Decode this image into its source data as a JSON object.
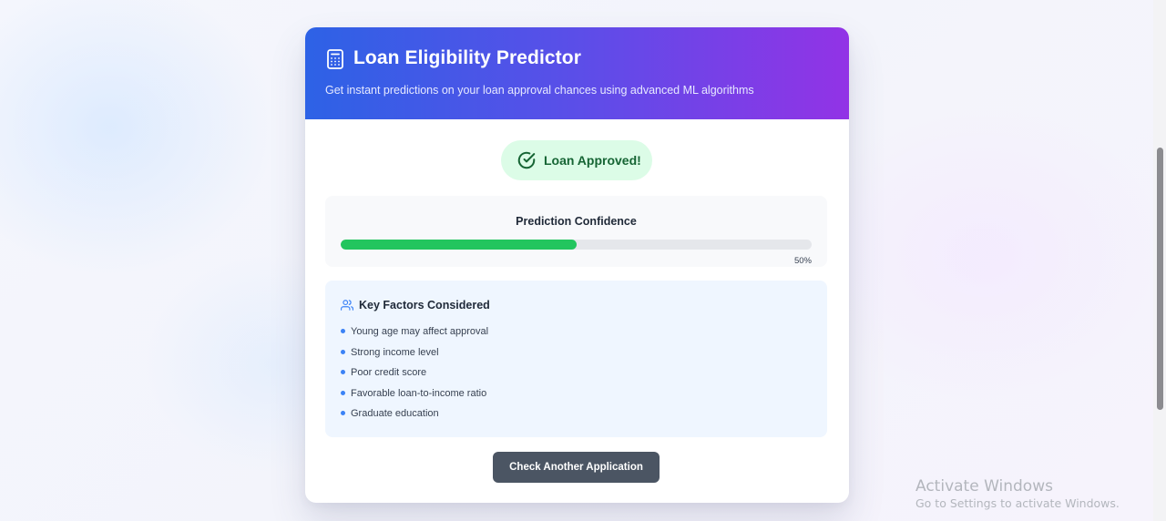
{
  "header": {
    "icon": "calculator-icon",
    "title": "Loan Eligibility Predictor",
    "subtitle": "Get instant predictions on your loan approval chances using advanced ML algorithms"
  },
  "result": {
    "icon": "check-circle-icon",
    "status": "Loan Approved!",
    "status_color": "#166534",
    "status_bg": "#dcfce7"
  },
  "confidence": {
    "title": "Prediction Confidence",
    "value": 0.5,
    "label": "50%",
    "bar_color": "#22c55e"
  },
  "factors": {
    "icon": "users-icon",
    "title": "Key Factors Considered",
    "items": [
      "Young age may affect approval",
      "Strong income level",
      "Poor credit score",
      "Favorable loan-to-income ratio",
      "Graduate education"
    ]
  },
  "actions": {
    "check_another_label": "Check Another Application"
  },
  "watermark": {
    "title": "Activate Windows",
    "subtitle": "Go to Settings to activate Windows."
  }
}
